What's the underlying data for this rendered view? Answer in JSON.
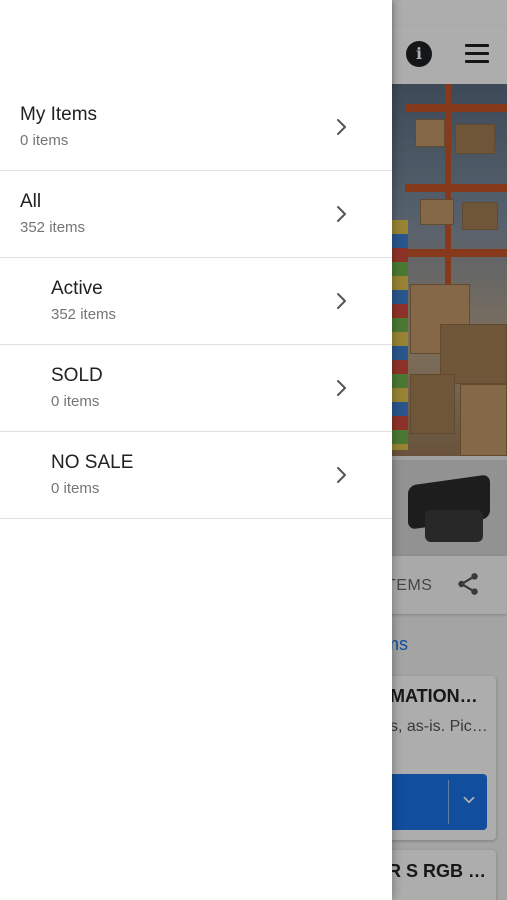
{
  "background": {
    "tab_items_label": "TEMS",
    "link_text": "ms",
    "card": {
      "title": "MATION…",
      "description": "s, as-is. Pic…"
    },
    "card2": {
      "title": "R S RGB …"
    }
  },
  "drawer": {
    "items": [
      {
        "title": "My Items",
        "count": "0 items",
        "indent": false
      },
      {
        "title": "All",
        "count": "352 items",
        "indent": false
      },
      {
        "title": "Active",
        "count": "352 items",
        "indent": true
      },
      {
        "title": "SOLD",
        "count": "0 items",
        "indent": true
      },
      {
        "title": "NO SALE",
        "count": "0 items",
        "indent": true
      }
    ]
  },
  "colors": {
    "accent": "#1a73e8",
    "scrim": "rgba(0,0,0,0.32)",
    "text_primary": "#212121",
    "text_secondary": "#757575"
  },
  "icons": {
    "info": "info-icon",
    "menu": "hamburger-menu-icon",
    "share": "share-icon",
    "row_chevron": "chevron-right-icon",
    "card_chevron": "chevron-down-icon"
  }
}
